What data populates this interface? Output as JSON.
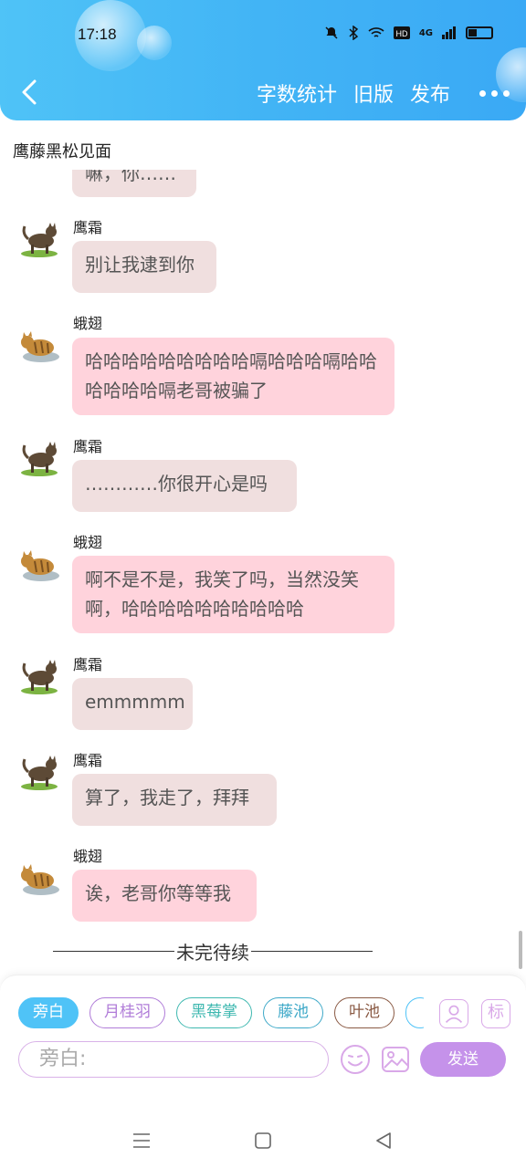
{
  "status_bar": {
    "time": "17:18",
    "network": "4G"
  },
  "header": {
    "links": [
      "字数统计",
      "旧版",
      "发布"
    ]
  },
  "page_title": "鹰藤黑松见面",
  "messages": [
    {
      "sender": "",
      "text": "嘛，你……",
      "style": "gray",
      "avatar": "none"
    },
    {
      "sender": "鹰霜",
      "text": "别让我逮到你",
      "style": "gray",
      "avatar": "cat-dark"
    },
    {
      "sender": "蛾翅",
      "text": "哈哈哈哈哈哈哈哈哈嗝哈哈哈嗝哈哈哈哈哈哈嗝老哥被骗了",
      "style": "pink",
      "avatar": "cat-tabby"
    },
    {
      "sender": "鹰霜",
      "text": "…………你很开心是吗",
      "style": "gray",
      "avatar": "cat-dark"
    },
    {
      "sender": "蛾翅",
      "text": "啊不是不是，我笑了吗，当然没笑啊，哈哈哈哈哈哈哈哈哈哈",
      "style": "pink",
      "avatar": "cat-tabby"
    },
    {
      "sender": "鹰霜",
      "text": "emmmmm",
      "style": "gray",
      "avatar": "cat-dark"
    },
    {
      "sender": "鹰霜",
      "text": "算了，我走了，拜拜",
      "style": "gray",
      "avatar": "cat-dark"
    },
    {
      "sender": "蛾翅",
      "text": "诶，老哥你等等我",
      "style": "pink",
      "avatar": "cat-tabby"
    }
  ],
  "divider_text": "未完待续",
  "characters": [
    {
      "name": "旁白",
      "active": true,
      "color": "#4fc3f7"
    },
    {
      "name": "月桂羽",
      "active": false,
      "color": "#b07cd8"
    },
    {
      "name": "黑莓掌",
      "active": false,
      "color": "#3fb8b0"
    },
    {
      "name": "藤池",
      "active": false,
      "color": "#3fa9c8"
    },
    {
      "name": "叶池",
      "active": false,
      "color": "#8a5a44"
    }
  ],
  "side_buttons": {
    "tag_label": "标"
  },
  "input": {
    "placeholder": "旁白:"
  },
  "send_label": "发送"
}
